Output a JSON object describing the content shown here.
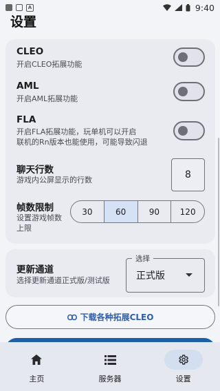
{
  "page_title": "设置",
  "status_bar": {
    "time": "9:40"
  },
  "settings": {
    "cleo": {
      "title": "CLEO",
      "subtitle": "开启CLEO拓展功能",
      "enabled": false
    },
    "aml": {
      "title": "AML",
      "subtitle": "开启AML拓展功能",
      "enabled": false
    },
    "fla": {
      "title": "FLA",
      "subtitle_line1": "开启FLA拓展功能，玩单机可以开启",
      "subtitle_line2": "联机的Rn版本也能使用，可能导致闪退",
      "enabled": false
    },
    "chat_lines": {
      "title": "聊天行数",
      "subtitle": "游戏内公屏显示的行数",
      "value": "8"
    },
    "fps_limit": {
      "title": "帧数限制",
      "subtitle_line1": "设置游戏帧数",
      "subtitle_line2": "上限",
      "options": [
        "30",
        "60",
        "90",
        "120"
      ],
      "selected": "60"
    }
  },
  "update_channel": {
    "title": "更新通道",
    "subtitle": "选择更新通道正式版/测试版",
    "select_label": "选择",
    "select_value": "正式版"
  },
  "download_button": {
    "label": "下载各种拓展CLEO"
  },
  "bottom_nav": {
    "items": [
      {
        "label": "主页",
        "icon": "home-icon"
      },
      {
        "label": "服务器",
        "icon": "server-list-icon"
      },
      {
        "label": "设置",
        "icon": "gear-icon"
      }
    ],
    "active": "设置"
  },
  "colors": {
    "accent": "#2f5fa8",
    "selected_segment": "#d5e1f5",
    "card_bg": "#e9ebf1"
  }
}
